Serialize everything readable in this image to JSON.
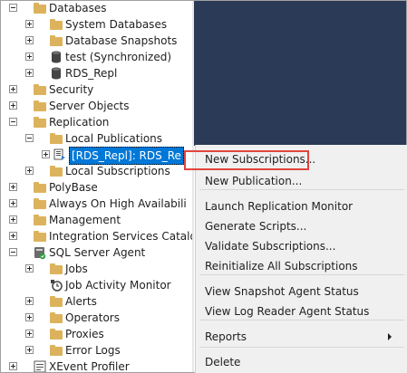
{
  "tree": {
    "nodes": [
      {
        "label": "Databases",
        "icon": "folder-icon",
        "expander": "minus"
      },
      {
        "label": "System Databases",
        "icon": "folder-icon",
        "expander": "plus"
      },
      {
        "label": "Database Snapshots",
        "icon": "folder-icon",
        "expander": "plus"
      },
      {
        "label": "test (Synchronized)",
        "icon": "database-icon",
        "expander": "plus"
      },
      {
        "label": "RDS_Repl",
        "icon": "database-icon",
        "expander": "plus"
      },
      {
        "label": "Security",
        "icon": "folder-icon",
        "expander": "plus"
      },
      {
        "label": "Server Objects",
        "icon": "folder-icon",
        "expander": "plus"
      },
      {
        "label": "Replication",
        "icon": "folder-icon",
        "expander": "minus"
      },
      {
        "label": "Local Publications",
        "icon": "folder-icon",
        "expander": "minus"
      },
      {
        "label": "[RDS_Repl]: RDS_Re",
        "icon": "publication-icon",
        "expander": "plus",
        "selected": true
      },
      {
        "label": "Local Subscriptions",
        "icon": "folder-icon",
        "expander": "plus"
      },
      {
        "label": "PolyBase",
        "icon": "folder-icon",
        "expander": "plus"
      },
      {
        "label": "Always On High Availabili",
        "icon": "folder-icon",
        "expander": "plus"
      },
      {
        "label": "Management",
        "icon": "folder-icon",
        "expander": "plus"
      },
      {
        "label": "Integration Services Catalo",
        "icon": "folder-icon",
        "expander": "plus"
      },
      {
        "label": "SQL Server Agent",
        "icon": "sql-agent-icon",
        "expander": "minus"
      },
      {
        "label": "Jobs",
        "icon": "folder-icon",
        "expander": "plus"
      },
      {
        "label": "Job Activity Monitor",
        "icon": "job-monitor-icon",
        "expander": ""
      },
      {
        "label": "Alerts",
        "icon": "folder-icon",
        "expander": "plus"
      },
      {
        "label": "Operators",
        "icon": "folder-icon",
        "expander": "plus"
      },
      {
        "label": "Proxies",
        "icon": "folder-icon",
        "expander": "plus"
      },
      {
        "label": "Error Logs",
        "icon": "folder-icon",
        "expander": "plus"
      },
      {
        "label": "XEvent Profiler",
        "icon": "xevent-icon",
        "expander": "plus"
      }
    ]
  },
  "context_menu": {
    "items": [
      {
        "label": "New Subscriptions...",
        "highlighted": true
      },
      {
        "label": "New Publication..."
      },
      {
        "label": "Launch Replication Monitor"
      },
      {
        "label": "Generate Scripts..."
      },
      {
        "label": "Validate Subscriptions..."
      },
      {
        "label": "Reinitialize All Subscriptions"
      },
      {
        "label": "View Snapshot Agent Status"
      },
      {
        "label": "View Log Reader Agent Status"
      },
      {
        "label": "Reports",
        "submenu": true
      },
      {
        "label": "Delete"
      }
    ]
  },
  "colors": {
    "selection": "#0078d7",
    "highlight_box": "#e0453d",
    "dark_pane": "#2b3a56",
    "folder": "#dcb35c"
  }
}
